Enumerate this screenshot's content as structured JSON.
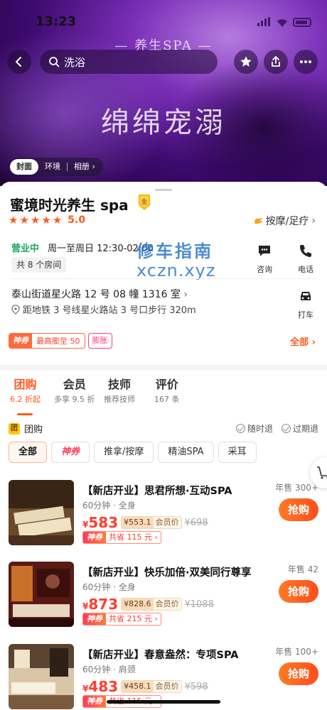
{
  "status_bar": {
    "time": "13:23"
  },
  "hero": {
    "brand_text": "— 养生SPA —",
    "slogan": "绵绵宠溺",
    "search_text": "洗浴",
    "tabs": [
      {
        "label": "封面",
        "active": true
      },
      {
        "label": "环境",
        "active": false
      },
      {
        "label": "相册 ›",
        "active": false
      }
    ]
  },
  "shop": {
    "name": "蜜境时光养生 spa",
    "badge_text": "金",
    "rating_stars": 5,
    "score": "5.0",
    "category": "按摩/足疗",
    "open_status": "营业中",
    "hours": "周一至周日 12:30-02:00",
    "rooms": "共 8 个房间",
    "consult_label": "咨询",
    "call_label": "电话",
    "address": "泰山街道星火路 12 号 08 幢 1316 室",
    "metro": "距地铁 3 号线星火路站 3 号口步行 320m",
    "taxi_label": "打车",
    "promo_tag": "神券",
    "promo_text": "最高膨至 50",
    "promo2": "膨胀",
    "all_label": "全部"
  },
  "watermark": {
    "line1": "修车指南",
    "line2": "xczn.xyz"
  },
  "tabs": [
    {
      "label": "团购",
      "sub": "6.2 折起",
      "active": true
    },
    {
      "label": "会员",
      "sub": "多享 9.5 折",
      "active": false
    },
    {
      "label": "技师",
      "sub": "推荐技师",
      "active": false
    },
    {
      "label": "评价",
      "sub": "167 条",
      "active": false
    }
  ],
  "group": {
    "icon_text": "团",
    "title": "团购",
    "policy1": "随时退",
    "policy2": "过期退",
    "filters": [
      "全部",
      "神券",
      "推拿/按摩",
      "精油SPA",
      "采耳"
    ]
  },
  "deals": [
    {
      "title": "【新店开业】思君所想·互动SPA",
      "meta": "60分钟 · 全身",
      "currency": "¥",
      "price": "583",
      "member_price": "¥553.1",
      "member_label": "会员价",
      "orig": "¥698",
      "save_tag": "神券",
      "save_text": "共省 115 元 ›",
      "sold": "年售 300+",
      "buy": "抢购"
    },
    {
      "title": "【新店开业】快乐加倍·双美同行尊享",
      "meta": "60分钟 · 全身",
      "currency": "¥",
      "price": "873",
      "member_price": "¥828.6",
      "member_label": "会员价",
      "orig": "¥1088",
      "save_tag": "神券",
      "save_text": "共省 215 元 ›",
      "sold": "年售 42",
      "buy": "抢购"
    },
    {
      "title": "【新店开业】春意盎然：专项SPA",
      "meta": "60分钟 · 肩颈",
      "currency": "¥",
      "price": "483",
      "member_price": "¥458.1",
      "member_label": "会员价",
      "orig": "¥598",
      "save_tag": "神券",
      "save_text": "共省 115 元 ›",
      "sold": "年售 100+",
      "buy": "抢购"
    }
  ],
  "colors": {
    "accent": "#ff5a1f",
    "open_green": "#1aa85a",
    "hero_purple": "#7b2fb8"
  }
}
